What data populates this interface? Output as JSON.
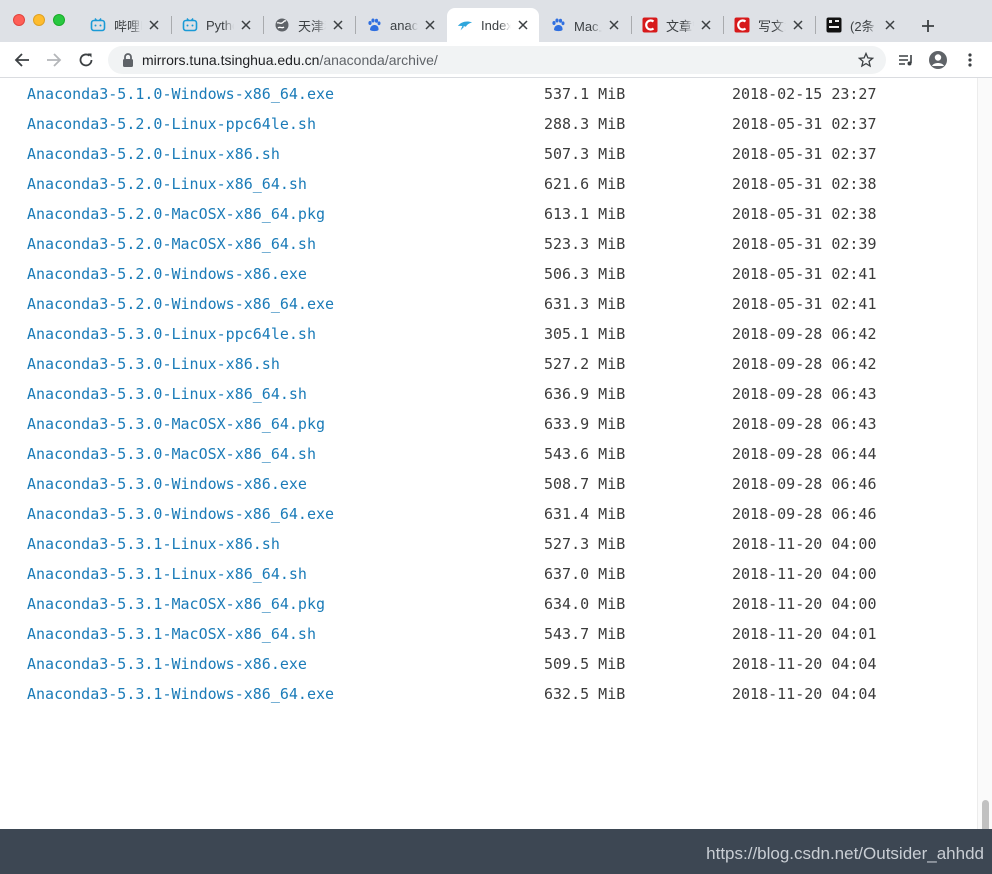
{
  "tabs": [
    {
      "title": "哔哩哔",
      "icon": "bilibili-icon"
    },
    {
      "title": "Pytho",
      "icon": "bilibili-icon"
    },
    {
      "title": "天津科",
      "icon": "globe-icon"
    },
    {
      "title": "anac",
      "icon": "baidu-paw-icon"
    },
    {
      "title": "Index",
      "icon": "tuna-icon",
      "active": true
    },
    {
      "title": "Mac上",
      "icon": "baidu-paw-icon"
    },
    {
      "title": "文章管",
      "icon": "csdn-icon"
    },
    {
      "title": "写文章",
      "icon": "csdn-icon"
    },
    {
      "title": "(2条",
      "icon": "dark-app-icon"
    }
  ],
  "address": {
    "host": "mirrors.tuna.tsinghua.edu.cn",
    "path": "/anaconda/archive/"
  },
  "files": [
    {
      "name": "Anaconda3-5.1.0-Windows-x86_64.exe",
      "size": "537.1 MiB",
      "date": "2018-02-15 23:27"
    },
    {
      "name": "Anaconda3-5.2.0-Linux-ppc64le.sh",
      "size": "288.3 MiB",
      "date": "2018-05-31 02:37"
    },
    {
      "name": "Anaconda3-5.2.0-Linux-x86.sh",
      "size": "507.3 MiB",
      "date": "2018-05-31 02:37"
    },
    {
      "name": "Anaconda3-5.2.0-Linux-x86_64.sh",
      "size": "621.6 MiB",
      "date": "2018-05-31 02:38"
    },
    {
      "name": "Anaconda3-5.2.0-MacOSX-x86_64.pkg",
      "size": "613.1 MiB",
      "date": "2018-05-31 02:38"
    },
    {
      "name": "Anaconda3-5.2.0-MacOSX-x86_64.sh",
      "size": "523.3 MiB",
      "date": "2018-05-31 02:39"
    },
    {
      "name": "Anaconda3-5.2.0-Windows-x86.exe",
      "size": "506.3 MiB",
      "date": "2018-05-31 02:41"
    },
    {
      "name": "Anaconda3-5.2.0-Windows-x86_64.exe",
      "size": "631.3 MiB",
      "date": "2018-05-31 02:41"
    },
    {
      "name": "Anaconda3-5.3.0-Linux-ppc64le.sh",
      "size": "305.1 MiB",
      "date": "2018-09-28 06:42"
    },
    {
      "name": "Anaconda3-5.3.0-Linux-x86.sh",
      "size": "527.2 MiB",
      "date": "2018-09-28 06:42"
    },
    {
      "name": "Anaconda3-5.3.0-Linux-x86_64.sh",
      "size": "636.9 MiB",
      "date": "2018-09-28 06:43"
    },
    {
      "name": "Anaconda3-5.3.0-MacOSX-x86_64.pkg",
      "size": "633.9 MiB",
      "date": "2018-09-28 06:43"
    },
    {
      "name": "Anaconda3-5.3.0-MacOSX-x86_64.sh",
      "size": "543.6 MiB",
      "date": "2018-09-28 06:44"
    },
    {
      "name": "Anaconda3-5.3.0-Windows-x86.exe",
      "size": "508.7 MiB",
      "date": "2018-09-28 06:46"
    },
    {
      "name": "Anaconda3-5.3.0-Windows-x86_64.exe",
      "size": "631.4 MiB",
      "date": "2018-09-28 06:46"
    },
    {
      "name": "Anaconda3-5.3.1-Linux-x86.sh",
      "size": "527.3 MiB",
      "date": "2018-11-20 04:00"
    },
    {
      "name": "Anaconda3-5.3.1-Linux-x86_64.sh",
      "size": "637.0 MiB",
      "date": "2018-11-20 04:00"
    },
    {
      "name": "Anaconda3-5.3.1-MacOSX-x86_64.pkg",
      "size": "634.0 MiB",
      "date": "2018-11-20 04:00"
    },
    {
      "name": "Anaconda3-5.3.1-MacOSX-x86_64.sh",
      "size": "543.7 MiB",
      "date": "2018-11-20 04:01"
    },
    {
      "name": "Anaconda3-5.3.1-Windows-x86.exe",
      "size": "509.5 MiB",
      "date": "2018-11-20 04:04"
    },
    {
      "name": "Anaconda3-5.3.1-Windows-x86_64.exe",
      "size": "632.5 MiB",
      "date": "2018-11-20 04:04"
    }
  ],
  "watermark": "https://blog.csdn.net/Outsider_ahhdd",
  "colors": {
    "link": "#1a7bb8",
    "tabstrip": "#dee1e6",
    "footer": "#3d4753"
  }
}
